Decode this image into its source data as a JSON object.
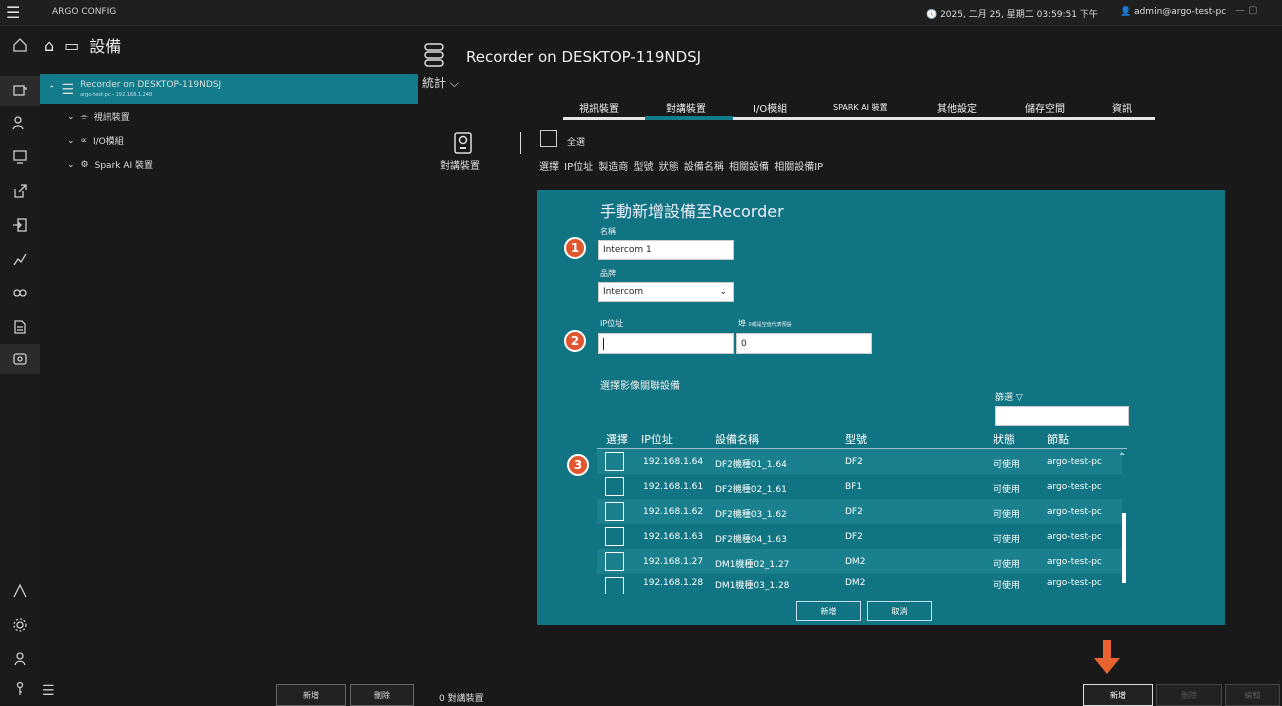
{
  "app": {
    "title": "ARGO CONFIG",
    "clock": "2025, 二月 25, 星期二 03:59:51 下午",
    "user": "admin@argo-test-pc"
  },
  "tree": {
    "title": "設備",
    "recorder": {
      "name": "Recorder on DESKTOP-119NDSJ",
      "sub": "argo-test-pc - 192.168.1.248"
    },
    "children": [
      {
        "label": "視訊裝置"
      },
      {
        "label": "I/O模組"
      },
      {
        "label": "Spark AI 裝置"
      }
    ],
    "add_label": "新增",
    "delete_label": "刪除"
  },
  "main": {
    "title": "Recorder on DESKTOP-119NDSJ",
    "stats_label": "統計",
    "tabs": [
      "視訊裝置",
      "對講裝置",
      "I/O模組",
      "SPARK AI 裝置",
      "其他設定",
      "儲存空間",
      "資訊"
    ],
    "active_tab": 1,
    "section_label": "對講裝置",
    "select_all": "全選",
    "columns": "選擇 IP位址 製造商 型號 狀態 設備名稱 相關設備 相關設備IP",
    "count": "0 對講裝置",
    "add_label": "新增",
    "delete_label": "刪除",
    "edit_label": "編輯"
  },
  "dialog": {
    "title": "手動新增設備至Recorder",
    "name_label": "名稱",
    "name_value": "Intercom 1",
    "brand_label": "品牌",
    "brand_value": "Intercom",
    "ip_label": "IP位址",
    "ip_value": "",
    "port_label": "埠",
    "port_hint": "0或是空值代表預設",
    "port_value": "0",
    "link_label": "選擇影像關聯設備",
    "filter_label": "篩選",
    "filter_value": "",
    "steps": [
      "1",
      "2",
      "3"
    ],
    "headers": [
      "選擇",
      "IP位址",
      "設備名稱",
      "型號",
      "狀態",
      "節點"
    ],
    "rows": [
      {
        "ip": "192.168.1.64",
        "name": "DF2機種01_1.64",
        "model": "DF2",
        "status": "可使用",
        "node": "argo-test-pc"
      },
      {
        "ip": "192.168.1.61",
        "name": "DF2機種02_1.61",
        "model": "BF1",
        "status": "可使用",
        "node": "argo-test-pc"
      },
      {
        "ip": "192.168.1.62",
        "name": "DF2機種03_1.62",
        "model": "DF2",
        "status": "可使用",
        "node": "argo-test-pc"
      },
      {
        "ip": "192.168.1.63",
        "name": "DF2機種04_1.63",
        "model": "DF2",
        "status": "可使用",
        "node": "argo-test-pc"
      },
      {
        "ip": "192.168.1.27",
        "name": "DM1機種02_1.27",
        "model": "DM2",
        "status": "可使用",
        "node": "argo-test-pc"
      },
      {
        "ip": "192.168.1.28",
        "name": "DM1機種03_1.28",
        "model": "DM2",
        "status": "可使用",
        "node": "argo-test-pc"
      }
    ],
    "add_button": "新增",
    "cancel_button": "取消"
  },
  "colors": {
    "accent": "#127c8a",
    "dialog_bg": "#117482",
    "step": "#e2562f",
    "arrow": "#e8632f"
  }
}
